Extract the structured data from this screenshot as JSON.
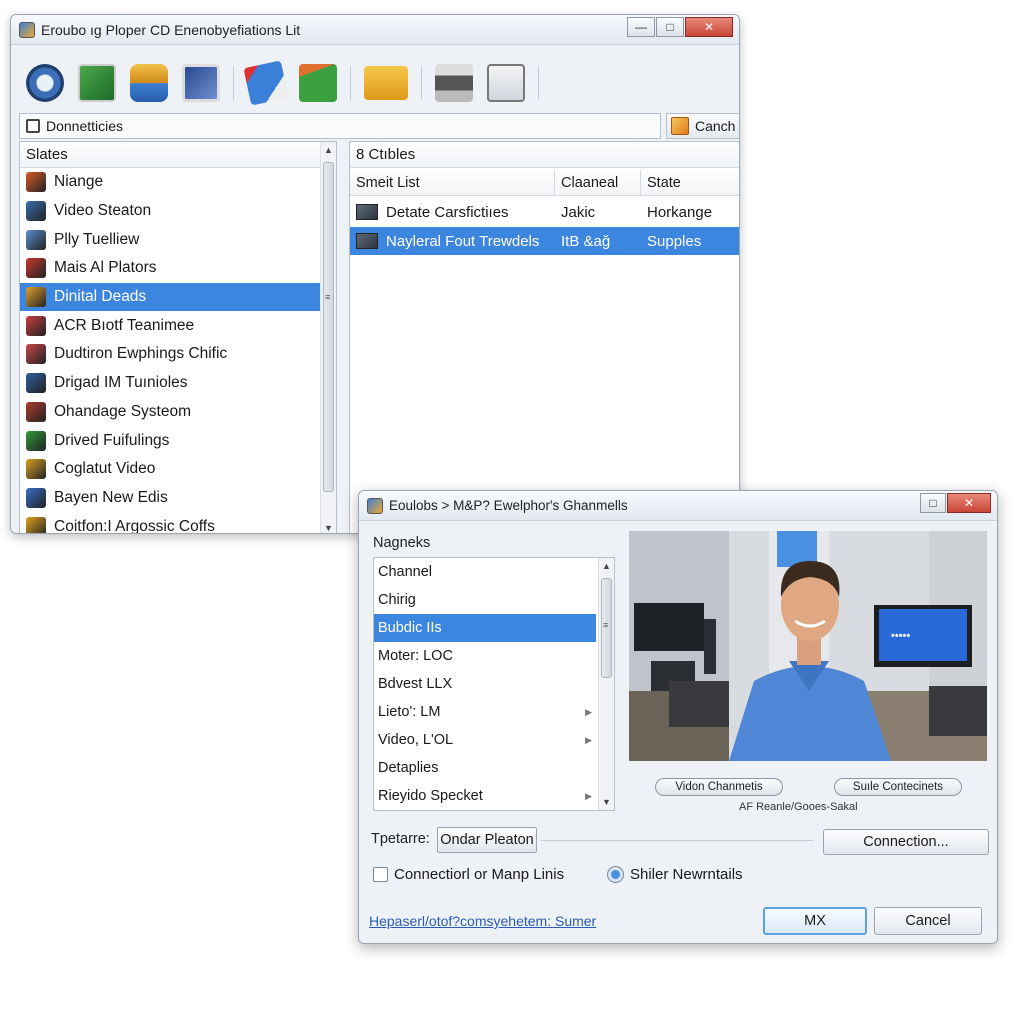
{
  "main_window": {
    "title": "Eroubo ıg Ploper CD Enenobyefiations Lit",
    "address": "Donnetticies",
    "cancel_label": "Canch",
    "toolbar_icons": [
      "power-icon",
      "device-icon",
      "database-icon",
      "monitor-icon",
      "network-card-icon",
      "green-card-icon",
      "folder-icon",
      "printer-icon",
      "save-icon"
    ],
    "left_pane": {
      "header": "Slates",
      "items": [
        {
          "label": "Niange",
          "icon": "folder-red-icon",
          "color": "#d85a2a"
        },
        {
          "label": "Video Steaton",
          "icon": "network-icon",
          "color": "#3a6fb0"
        },
        {
          "label": "Plly Tuelliew",
          "icon": "diamond-icon",
          "color": "#5a8fd0"
        },
        {
          "label": "Mais Al Plators",
          "icon": "power-red-icon",
          "color": "#c83a30"
        },
        {
          "label": "Dinital Deads",
          "icon": "box-icon",
          "color": "#e0a030"
        },
        {
          "label": "ACR Bıotf Teanimee",
          "icon": "hook-icon",
          "color": "#c84040"
        },
        {
          "label": "Dudtiron Ewphings Chific",
          "icon": "tools-icon",
          "color": "#c84848"
        },
        {
          "label": "Drigad IM Tuınioles",
          "icon": "chip-icon",
          "color": "#2f5f9a"
        },
        {
          "label": "Ohandage Systeom",
          "icon": "gear-icon",
          "color": "#b03a2e"
        },
        {
          "label": "Drived Fuifulings",
          "icon": "green-disk-icon",
          "color": "#2f9a3a"
        },
        {
          "label": "Coglatut Video",
          "icon": "chrome-icon",
          "color": "#d9a020"
        },
        {
          "label": "Bayen New Edis",
          "icon": "lock-blue-icon",
          "color": "#3a6fc8"
        },
        {
          "label": "Coitfon:I Argossic Coffs",
          "icon": "lock-gold-icon",
          "color": "#e0a020"
        }
      ],
      "selected_index": 4
    },
    "right_pane": {
      "header": "8 Ctıbles",
      "columns": [
        "Smeit List",
        "Claaneal",
        "State"
      ],
      "rows": [
        [
          "Detate Carsfictiıes",
          "Jakic",
          "Horkange"
        ],
        [
          "Nayleral Fout Trewdels",
          "ItB &ağ",
          "Supples"
        ]
      ],
      "selected_row": 1
    }
  },
  "dialog": {
    "title": "Eoulobs > M&P? Ewelphor's Ghanmells",
    "list_label": "Nagneks",
    "channels": [
      "Channel",
      "Chirig",
      "Bubdic IIs",
      "Moter: LOC",
      "Bdvest LLX",
      "Lieto': LM",
      "Video, L'OL",
      "Detaplies",
      "Rieyido Specket"
    ],
    "selected_channel": 2,
    "video_buttons": [
      "Vidon Chanmetis",
      "Suıle Contecinets"
    ],
    "video_caption": "AF Reanle/Gooes-Sakal",
    "type_label": "Tpetarre:",
    "type_value": "Ondar Pleaton",
    "connection_button": "Connection...",
    "checkbox_label": "Connectiorl or Manp Linis",
    "radio_label": "Shiler Newrntails",
    "link_text": "Hepaserl/otof?comsyehetem: Sumer",
    "ok_label": "MX",
    "cancel_label": "Cancel"
  }
}
